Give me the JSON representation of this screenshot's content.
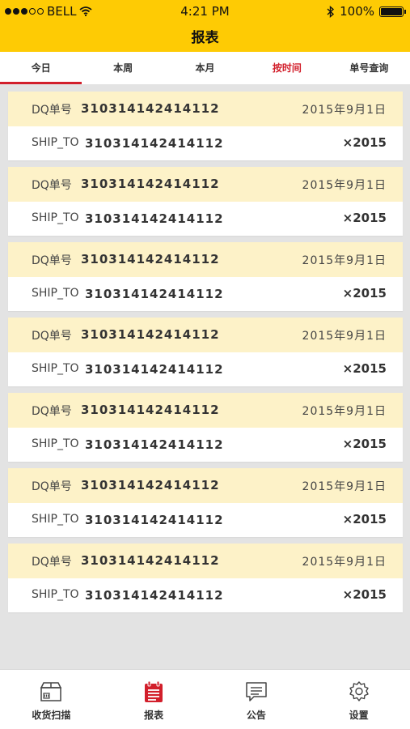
{
  "status_bar": {
    "carrier": "BELL",
    "time": "4:21 PM",
    "battery": "100%"
  },
  "nav": {
    "title": "报表"
  },
  "tabs": [
    {
      "label": "今日",
      "selected": true
    },
    {
      "label": "本周",
      "selected": false
    },
    {
      "label": "本月",
      "selected": false
    },
    {
      "label": "按时间",
      "selected": false
    },
    {
      "label": "单号查询",
      "selected": false
    }
  ],
  "records": [
    {
      "dq_label": "DQ单号",
      "dq_no": "310314142414112",
      "date": "2015年9月1日",
      "ship_label": "SHIP_TO",
      "ship_no": "310314142414112",
      "qty": "×2015"
    },
    {
      "dq_label": "DQ单号",
      "dq_no": "310314142414112",
      "date": "2015年9月1日",
      "ship_label": "SHIP_TO",
      "ship_no": "310314142414112",
      "qty": "×2015"
    },
    {
      "dq_label": "DQ单号",
      "dq_no": "310314142414112",
      "date": "2015年9月1日",
      "ship_label": "SHIP_TO",
      "ship_no": "310314142414112",
      "qty": "×2015"
    },
    {
      "dq_label": "DQ单号",
      "dq_no": "310314142414112",
      "date": "2015年9月1日",
      "ship_label": "SHIP_TO",
      "ship_no": "310314142414112",
      "qty": "×2015"
    },
    {
      "dq_label": "DQ单号",
      "dq_no": "310314142414112",
      "date": "2015年9月1日",
      "ship_label": "SHIP_TO",
      "ship_no": "310314142414112",
      "qty": "×2015"
    },
    {
      "dq_label": "DQ单号",
      "dq_no": "310314142414112",
      "date": "2015年9月1日",
      "ship_label": "SHIP_TO",
      "ship_no": "310314142414112",
      "qty": "×2015"
    },
    {
      "dq_label": "DQ单号",
      "dq_no": "310314142414112",
      "date": "2015年9月1日",
      "ship_label": "SHIP_TO",
      "ship_no": "310314142414112",
      "qty": "×2015"
    }
  ],
  "tabbar": [
    {
      "label": "收货扫描",
      "icon": "box-scan-icon",
      "active": false
    },
    {
      "label": "报表",
      "icon": "report-icon",
      "active": true
    },
    {
      "label": "公告",
      "icon": "message-icon",
      "active": false
    },
    {
      "label": "设置",
      "icon": "gear-icon",
      "active": false
    }
  ],
  "colors": {
    "brand_yellow": "#fecb04",
    "accent_red": "#d21f2b",
    "row_highlight": "#fdf2c8",
    "background": "#e3e3e3"
  }
}
